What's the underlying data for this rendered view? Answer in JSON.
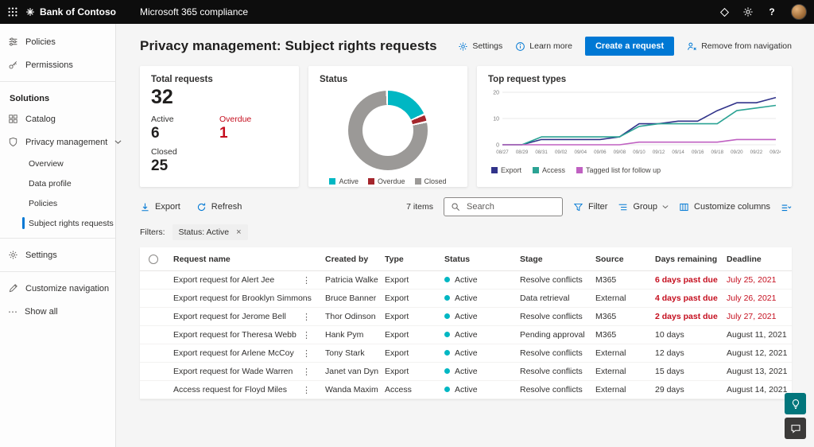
{
  "topbar": {
    "brand": "Bank of Contoso",
    "app_title": "Microsoft 365 compliance"
  },
  "sidebar": {
    "items_top": [
      {
        "label": "Policies"
      },
      {
        "label": "Permissions"
      }
    ],
    "solutions_header": "Solutions",
    "items_solutions": [
      {
        "label": "Catalog"
      },
      {
        "label": "Privacy management"
      }
    ],
    "privacy_children": [
      {
        "label": "Overview",
        "selected": false
      },
      {
        "label": "Data profile",
        "selected": false
      },
      {
        "label": "Policies",
        "selected": false
      },
      {
        "label": "Subject rights requests",
        "selected": true
      }
    ],
    "settings_label": "Settings",
    "customize_label": "Customize navigation",
    "show_all_label": "Show all"
  },
  "header": {
    "title": "Privacy management: Subject rights requests",
    "actions": {
      "settings": "Settings",
      "learn_more": "Learn more",
      "create_request": "Create a request",
      "remove_nav": "Remove from navigation"
    }
  },
  "cards": {
    "total": {
      "title": "Total requests",
      "total": "32",
      "active_label": "Active",
      "active": "6",
      "overdue_label": "Overdue",
      "overdue": "1",
      "closed_label": "Closed",
      "closed": "25"
    },
    "status": {
      "title": "Status"
    },
    "trend": {
      "title": "Top request types"
    }
  },
  "chart_data": [
    {
      "type": "pie",
      "title": "Status",
      "labels": [
        "Active",
        "Overdue",
        "Closed"
      ],
      "values": [
        6,
        1,
        25
      ],
      "colors": [
        "#00b7c3",
        "#a4262c",
        "#9b9997"
      ],
      "donut": true,
      "legend_position": "bottom"
    },
    {
      "type": "line",
      "title": "Top request types",
      "x": [
        "08/27",
        "08/29",
        "08/31",
        "09/02",
        "09/04",
        "09/06",
        "09/08",
        "09/10",
        "09/12",
        "09/14",
        "09/16",
        "09/18",
        "09/20",
        "09/22",
        "09/24"
      ],
      "series": [
        {
          "name": "Export",
          "color": "#31338a",
          "values": [
            0,
            0,
            2,
            2,
            2,
            2,
            3,
            8,
            8,
            9,
            9,
            13,
            16,
            16,
            18
          ]
        },
        {
          "name": "Access",
          "color": "#2ba394",
          "values": [
            0,
            0,
            3,
            3,
            3,
            3,
            3,
            7,
            8,
            8,
            8,
            8,
            13,
            14,
            15
          ]
        },
        {
          "name": "Tagged list for follow up",
          "color": "#c061c2",
          "values": [
            0,
            0,
            0,
            0,
            0,
            0,
            0,
            1,
            1,
            1,
            1,
            1,
            2,
            2,
            2
          ]
        }
      ],
      "ylim": [
        0,
        20
      ],
      "yticks": [
        0,
        10,
        20
      ],
      "grid": true,
      "legend_position": "bottom"
    }
  ],
  "toolbar": {
    "export": "Export",
    "refresh": "Refresh",
    "items_count": "7 items",
    "search_placeholder": "Search",
    "filter": "Filter",
    "group": "Group",
    "customize_columns": "Customize columns"
  },
  "filters": {
    "label": "Filters:",
    "chips": [
      {
        "text": "Status: Active"
      }
    ]
  },
  "table": {
    "columns": [
      "Request name",
      "Created by",
      "Type",
      "Status",
      "Stage",
      "Source",
      "Days remaining",
      "Deadline"
    ],
    "sorted_column": "Days remaining",
    "rows": [
      {
        "name": "Export request for Alert Jee",
        "created_by": "Patricia Walker",
        "type": "Export",
        "status": "Active",
        "stage": "Resolve conflicts",
        "source": "M365",
        "days": "6 days past due",
        "deadline": "July 25, 2021",
        "overdue": true
      },
      {
        "name": "Export request for Brooklyn Simmons",
        "created_by": "Bruce Banner",
        "type": "Export",
        "status": "Active",
        "stage": "Data retrieval",
        "source": "External",
        "days": "4 days past due",
        "deadline": "July 26, 2021",
        "overdue": true
      },
      {
        "name": "Export request for Jerome Bell",
        "created_by": "Thor Odinson",
        "type": "Export",
        "status": "Active",
        "stage": "Resolve conflicts",
        "source": "M365",
        "days": "2 days past due",
        "deadline": "July 27, 2021",
        "overdue": true
      },
      {
        "name": "Export request for Theresa Webb",
        "created_by": "Hank Pym",
        "type": "Export",
        "status": "Active",
        "stage": "Pending approval",
        "source": "M365",
        "days": "10 days",
        "deadline": "August 11, 2021",
        "overdue": false
      },
      {
        "name": "Export request for Arlene McCoy",
        "created_by": "Tony Stark",
        "type": "Export",
        "status": "Active",
        "stage": "Resolve conflicts",
        "source": "External",
        "days": "12 days",
        "deadline": "August 12, 2021",
        "overdue": false
      },
      {
        "name": "Export request for Wade Warren",
        "created_by": "Janet van Dyne",
        "type": "Export",
        "status": "Active",
        "stage": "Resolve conflicts",
        "source": "External",
        "days": "15 days",
        "deadline": "August 13, 2021",
        "overdue": false
      },
      {
        "name": "Access request for Floyd Miles",
        "created_by": "Wanda Maximoff",
        "type": "Access",
        "status": "Active",
        "stage": "Resolve conflicts",
        "source": "External",
        "days": "29 days",
        "deadline": "August 14, 2021",
        "overdue": false
      }
    ]
  },
  "icons": {
    "sort_desc": "↓",
    "row_actions": "⋮",
    "chip_close": "×",
    "show_all_glyph": "⋯",
    "help": "?"
  },
  "colors": {
    "accent": "#0078d4",
    "active_dot": "#00b7c3",
    "alert": "#c50f1f",
    "overdue_segment": "#a4262c",
    "closed_segment": "#9b9997"
  }
}
